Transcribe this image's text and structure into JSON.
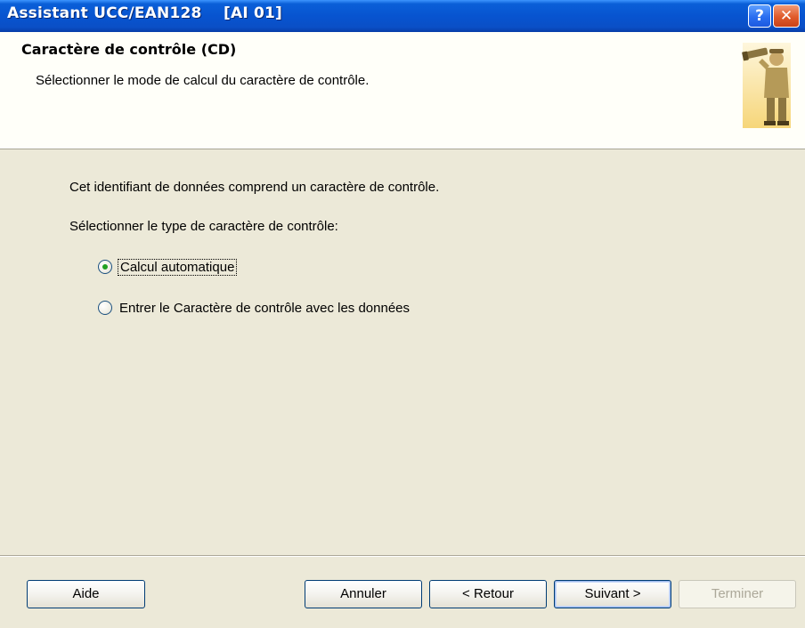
{
  "window": {
    "title": "Assistant UCC/EAN128    [AI 01]",
    "help_glyph": "?",
    "close_glyph": "✕"
  },
  "header": {
    "title": "Caractère de contrôle (CD)",
    "subtitle": "Sélectionner le mode de calcul du caractère de contrôle.",
    "icon": "telescope-figure-icon"
  },
  "body": {
    "info": "Cet identifiant de données comprend un caractère de contrôle.",
    "prompt": "Sélectionner le type de caractère de contrôle:",
    "options": [
      {
        "label": "Calcul automatique",
        "checked": true
      },
      {
        "label": "Entrer le Caractère de contrôle avec les données",
        "checked": false
      }
    ]
  },
  "buttons": {
    "help": "Aide",
    "cancel": "Annuler",
    "back": "< Retour",
    "next": "Suivant >",
    "finish": "Terminer",
    "finish_enabled": false
  },
  "colors": {
    "titlebar": "#0754d0",
    "dialog_bg": "#ece9d8",
    "header_bg": "#fffff9",
    "close_button": "#e05a2a"
  }
}
